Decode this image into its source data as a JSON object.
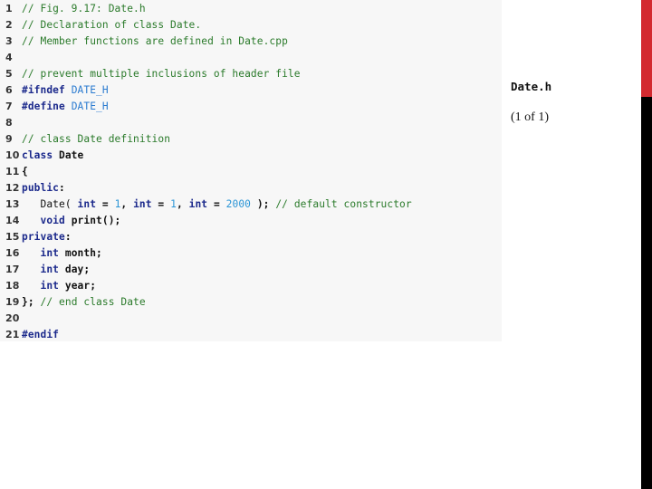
{
  "slide": {
    "file_title": "Date.h",
    "page_count": "(1 of 1)",
    "accent_colors": {
      "red_bar": "#d32a30",
      "black_bar": "#000000"
    }
  },
  "code": {
    "lines": [
      {
        "n": "1",
        "tokens": [
          [
            "cm",
            "// Fig. 9.17: Date.h"
          ]
        ]
      },
      {
        "n": "2",
        "tokens": [
          [
            "cm",
            "// Declaration of class Date."
          ]
        ]
      },
      {
        "n": "3",
        "tokens": [
          [
            "cm",
            "// Member functions are defined in Date.cpp"
          ]
        ]
      },
      {
        "n": "4",
        "tokens": []
      },
      {
        "n": "5",
        "tokens": [
          [
            "cm",
            "// prevent multiple inclusions of header file"
          ]
        ]
      },
      {
        "n": "6",
        "tokens": [
          [
            "pp",
            "#ifndef "
          ],
          [
            "mac",
            "DATE_H"
          ]
        ]
      },
      {
        "n": "7",
        "tokens": [
          [
            "pp",
            "#define "
          ],
          [
            "mac",
            "DATE_H"
          ]
        ]
      },
      {
        "n": "8",
        "tokens": []
      },
      {
        "n": "9",
        "tokens": [
          [
            "cm",
            "// class Date definition"
          ]
        ]
      },
      {
        "n": "10",
        "tokens": [
          [
            "kw",
            "class "
          ],
          [
            "id",
            "Date"
          ]
        ]
      },
      {
        "n": "11",
        "tokens": [
          [
            "id",
            "{"
          ]
        ]
      },
      {
        "n": "12",
        "tokens": [
          [
            "kw",
            "public"
          ],
          [
            "id",
            ":"
          ]
        ]
      },
      {
        "n": "13",
        "tokens": [
          [
            "id-plain",
            "   Date( "
          ],
          [
            "kw",
            "int"
          ],
          [
            "id",
            " = "
          ],
          [
            "num",
            "1"
          ],
          [
            "id",
            ", "
          ],
          [
            "kw",
            "int"
          ],
          [
            "id",
            " = "
          ],
          [
            "num",
            "1"
          ],
          [
            "id",
            ", "
          ],
          [
            "kw",
            "int"
          ],
          [
            "id",
            " = "
          ],
          [
            "num",
            "2000"
          ],
          [
            "id",
            " ); "
          ],
          [
            "cm",
            "// default constructor"
          ]
        ]
      },
      {
        "n": "14",
        "tokens": [
          [
            "kw",
            "   void "
          ],
          [
            "id",
            "print();"
          ]
        ]
      },
      {
        "n": "15",
        "tokens": [
          [
            "kw",
            "private"
          ],
          [
            "id",
            ":"
          ]
        ]
      },
      {
        "n": "16",
        "tokens": [
          [
            "kw",
            "   int "
          ],
          [
            "id",
            "month;"
          ]
        ]
      },
      {
        "n": "17",
        "tokens": [
          [
            "kw",
            "   int "
          ],
          [
            "id",
            "day;"
          ]
        ]
      },
      {
        "n": "18",
        "tokens": [
          [
            "kw",
            "   int "
          ],
          [
            "id",
            "year;"
          ]
        ]
      },
      {
        "n": "19",
        "tokens": [
          [
            "id",
            "}; "
          ],
          [
            "cm",
            "// end class Date"
          ]
        ]
      },
      {
        "n": "20",
        "tokens": []
      },
      {
        "n": "21",
        "tokens": [
          [
            "pp",
            "#endif"
          ]
        ]
      }
    ]
  }
}
